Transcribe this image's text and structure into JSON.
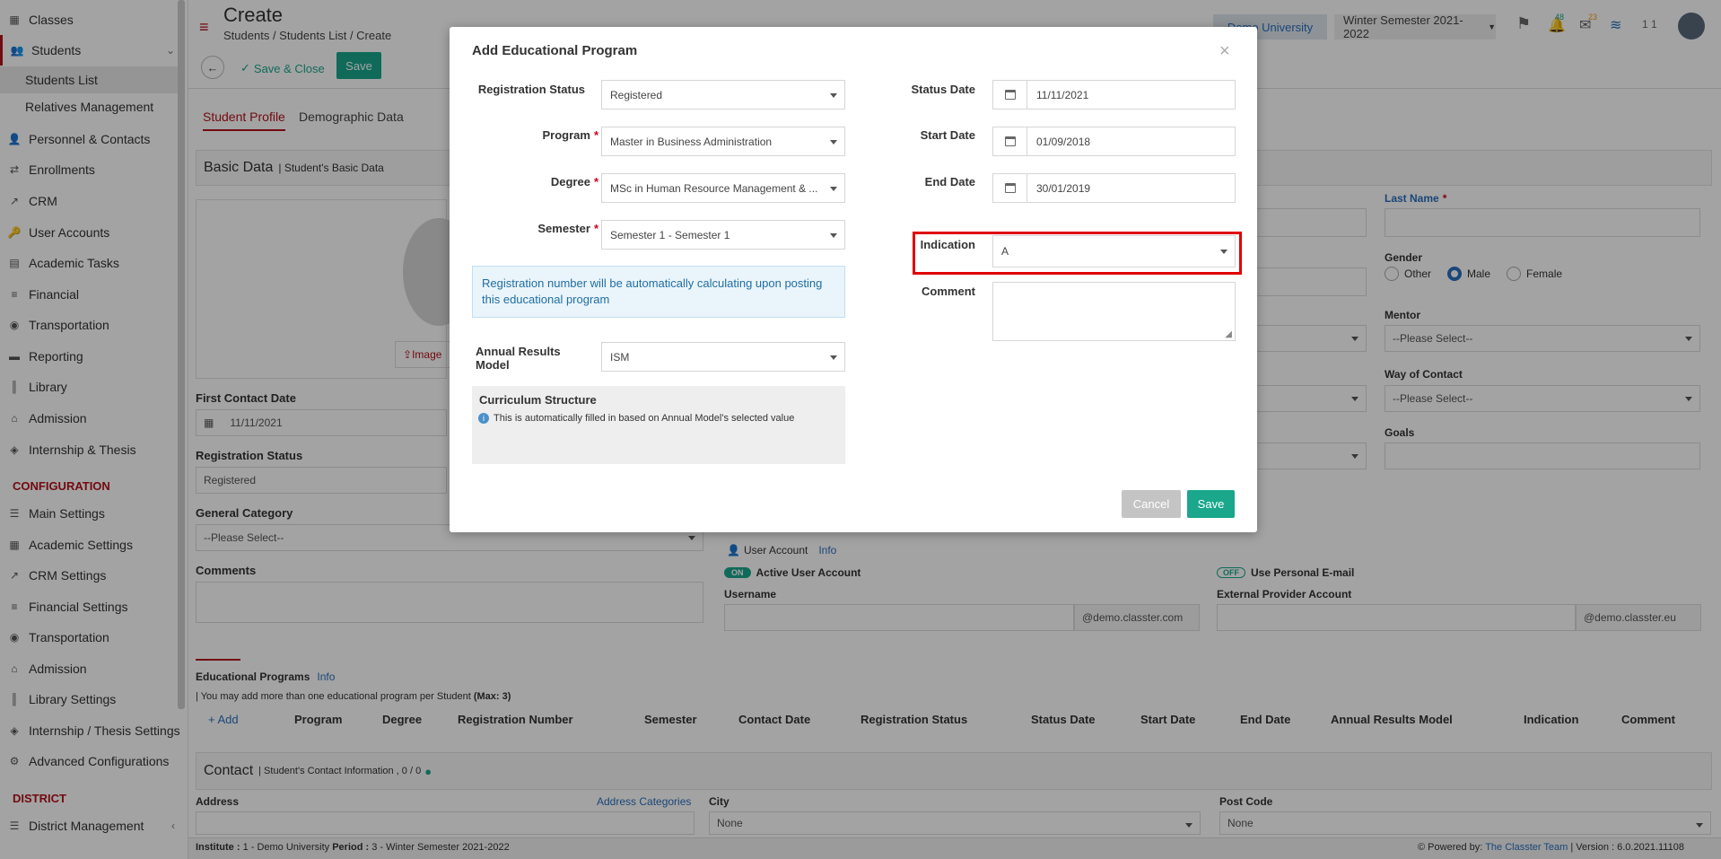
{
  "sidebar": {
    "items": [
      {
        "label": "Classes",
        "icon": "classes-icon"
      },
      {
        "label": "Students",
        "icon": "students-icon"
      },
      {
        "label": "Personnel & Contacts",
        "icon": "personnel-icon"
      },
      {
        "label": "Enrollments",
        "icon": "enrollments-icon"
      },
      {
        "label": "CRM",
        "icon": "crm-icon"
      },
      {
        "label": "User Accounts",
        "icon": "user-accounts-icon"
      },
      {
        "label": "Academic Tasks",
        "icon": "academic-tasks-icon"
      },
      {
        "label": "Financial",
        "icon": "financial-icon"
      },
      {
        "label": "Transportation",
        "icon": "transportation-icon"
      },
      {
        "label": "Reporting",
        "icon": "reporting-icon"
      },
      {
        "label": "Library",
        "icon": "library-icon"
      },
      {
        "label": "Admission",
        "icon": "admission-icon"
      },
      {
        "label": "Internship & Thesis",
        "icon": "internship-icon"
      }
    ],
    "students_sub": [
      "Students List",
      "Relatives Management"
    ],
    "config_heading": "CONFIGURATION",
    "config_items": [
      {
        "label": "Main Settings"
      },
      {
        "label": "Academic Settings"
      },
      {
        "label": "CRM Settings"
      },
      {
        "label": "Financial Settings"
      },
      {
        "label": "Transportation"
      },
      {
        "label": "Admission"
      },
      {
        "label": "Library Settings"
      },
      {
        "label": "Internship / Thesis Settings"
      },
      {
        "label": "Advanced Configurations"
      }
    ],
    "district_heading": "DISTRICT",
    "district_items": [
      {
        "label": "District Management"
      }
    ]
  },
  "header": {
    "title": "Create",
    "breadcrumb": [
      "Students",
      "Students List",
      "Create"
    ],
    "institution": "Demo University",
    "semester": "Winter Semester 2021-2022",
    "badge_notifications": "48",
    "badge_messages": "23",
    "user_initials": "1 1"
  },
  "toolbar": {
    "save_close": "Save & Close",
    "save": "Save"
  },
  "tabs": [
    "Student Profile",
    "Demographic Data"
  ],
  "basic": {
    "title": "Basic Data",
    "subtitle": "| Student's Basic Data",
    "image_label": "Image",
    "first_contact_label": "First Contact Date",
    "first_contact_value": "11/11/2021",
    "reg_status_label": "Registration Status",
    "reg_status_value": "Registered",
    "general_category_label": "General Category",
    "general_category_value": "--Please Select--",
    "comments_label": "Comments",
    "last_name_label": "Last Name",
    "gender_label": "Gender",
    "gender_options": [
      "Other",
      "Male",
      "Female"
    ],
    "mentor_label": "Mentor",
    "mentor_value": "--Please Select--",
    "way_label": "Way of Contact",
    "way_value": "--Please Select--",
    "goals_label": "Goals"
  },
  "account": {
    "user_account": "User Account",
    "info": "Info",
    "toggle_on": "ON",
    "active_label": "Active User Account",
    "toggle_off": "OFF",
    "personal_email": "Use Personal E-mail",
    "username_label": "Username",
    "username_suffix": "@demo.classter.com",
    "external_label": "External Provider Account",
    "external_suffix": "@demo.classter.eu"
  },
  "programs": {
    "title": "Educational Programs",
    "info": "Info",
    "note": "| You may add more than one educational program per Student",
    "max": "(Max: 3)",
    "add": "+ Add",
    "columns": [
      "Program",
      "Degree",
      "Registration Number",
      "Semester",
      "Contact Date",
      "Registration Status",
      "Status Date",
      "Start Date",
      "End Date",
      "Annual Results Model",
      "Indication",
      "Comment"
    ]
  },
  "contact": {
    "title": "Contact",
    "subtitle": "| Student's Contact Information , 0 / 0",
    "address_label": "Address",
    "address_categories": "Address Categories",
    "city_label": "City",
    "city_value": "None",
    "postcode_label": "Post Code",
    "postcode_value": "None"
  },
  "footer": {
    "institute_label": "Institute :",
    "institute_value": "1 - Demo University",
    "period_label": "Period :",
    "period_value": "3 - Winter Semester 2021-2022",
    "powered": "Powered by:",
    "team": "The Classter Team",
    "version": "| Version : 6.0.2021.11108"
  },
  "modal": {
    "title": "Add Educational Program",
    "registration_status_label": "Registration Status",
    "registration_status_value": "Registered",
    "program_label": "Program",
    "program_value": "Master in Business Administration",
    "degree_label": "Degree",
    "degree_value": "MSc in Human Resource Management & ...",
    "semester_label": "Semester",
    "semester_value": "Semester 1 - Semester 1",
    "info_text": "Registration number will be automatically calculating upon posting this educational program",
    "annual_label": "Annual Results Model",
    "annual_value": "ISM",
    "curriculum_title": "Curriculum Structure",
    "curriculum_note": "This is automatically filled in based on Annual Model's selected value",
    "status_date_label": "Status Date",
    "status_date_value": "11/11/2021",
    "start_date_label": "Start Date",
    "start_date_value": "01/09/2018",
    "end_date_label": "End Date",
    "end_date_value": "30/01/2019",
    "indication_label": "Indication",
    "indication_value": "A",
    "comment_label": "Comment",
    "cancel": "Cancel",
    "save": "Save"
  },
  "colors": {
    "accent": "#1aa78c",
    "brand_red": "#b3121a",
    "highlight": "#e00000",
    "link": "#2a6fbd"
  }
}
